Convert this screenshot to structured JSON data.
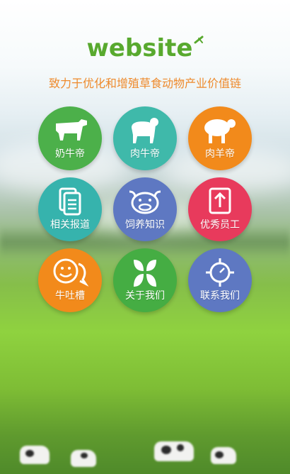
{
  "brand": {
    "logo_text": "website",
    "tagline": "致力于优化和增殖草食动物产业价值链"
  },
  "colors": {
    "brand_green": "#58a92e",
    "tagline_orange": "#ee8a2c"
  },
  "menu": [
    {
      "label": "奶牛帝",
      "icon": "dairy-cow-icon",
      "color": "#4cb04a"
    },
    {
      "label": "肉牛帝",
      "icon": "beef-cattle-icon",
      "color": "#3fb9aa"
    },
    {
      "label": "肉羊帝",
      "icon": "sheep-icon",
      "color": "#f28a1b"
    },
    {
      "label": "相关报道",
      "icon": "documents-icon",
      "color": "#36b3ad"
    },
    {
      "label": "饲养知识",
      "icon": "cow-face-icon",
      "color": "#5e78c2"
    },
    {
      "label": "优秀员工",
      "icon": "upload-icon",
      "color": "#e83a5c"
    },
    {
      "label": "牛吐槽",
      "icon": "chat-bubble-icon",
      "color": "#f28a1b"
    },
    {
      "label": "关于我们",
      "icon": "leaf-cross-icon",
      "color": "#45ad43"
    },
    {
      "label": "联系我们",
      "icon": "compass-icon",
      "color": "#5e78c2"
    }
  ]
}
